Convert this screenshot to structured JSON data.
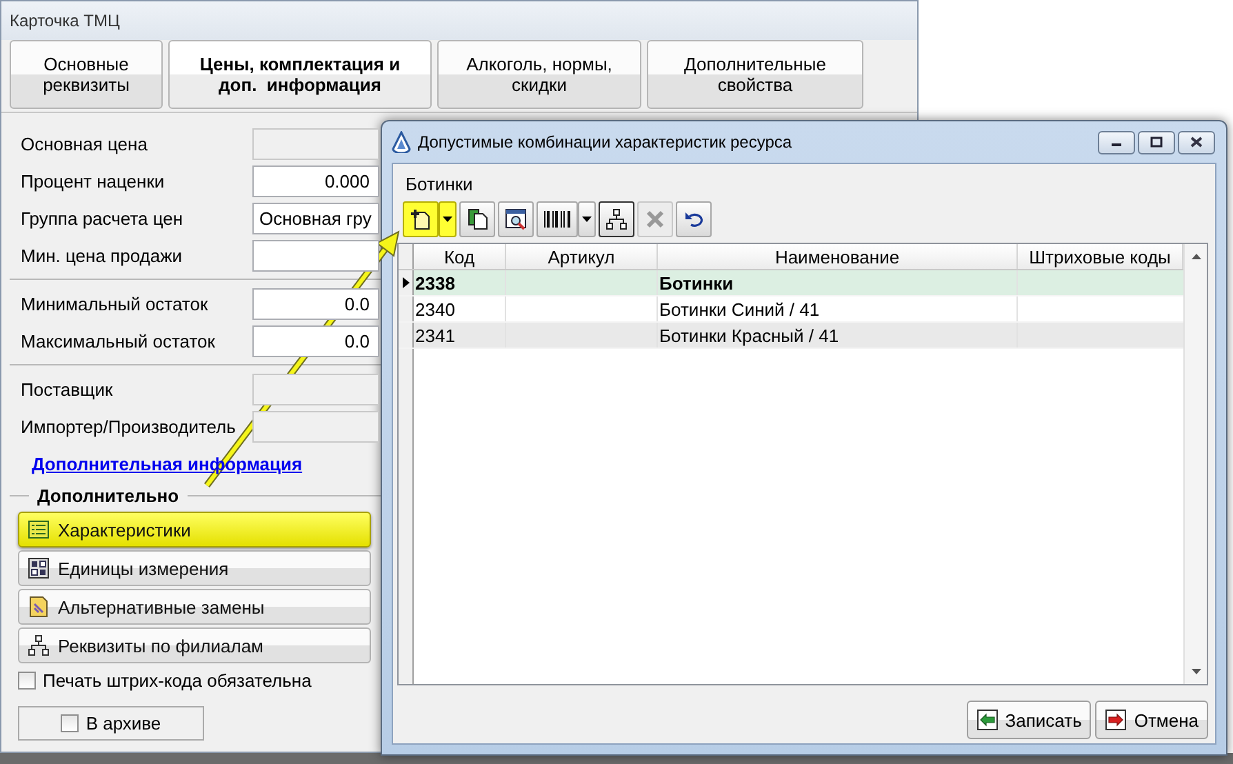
{
  "main_window": {
    "title": "Карточка ТМЦ",
    "tabs": [
      {
        "label": "Основные реквизиты",
        "selected": false
      },
      {
        "label": "Цены, комплектация и доп.  информация",
        "selected": true
      },
      {
        "label": "Алкоголь, нормы, скидки",
        "selected": false
      },
      {
        "label": "Дополнительные свойства",
        "selected": false
      }
    ],
    "field_groups": [
      [
        {
          "label": "Основная цена",
          "kind": "readonly"
        },
        {
          "label": "Процент наценки",
          "kind": "number",
          "value": "0.000"
        },
        {
          "label": "Группа расчета цен",
          "kind": "text",
          "value": "Основная гру"
        },
        {
          "label": "Мин. цена продажи",
          "kind": "number"
        }
      ],
      [
        {
          "label": "Минимальный остаток",
          "kind": "number",
          "value": "0.0"
        },
        {
          "label": "Максимальный остаток",
          "kind": "number",
          "value": "0.0"
        }
      ],
      [
        {
          "label": "Поставщик",
          "kind": "readonly"
        },
        {
          "label": "Импортер/Производитель",
          "kind": "readonly"
        }
      ]
    ],
    "link": "Дополнительная информация",
    "section_title": "Дополнительно",
    "buttons": [
      {
        "label": "Характеристики",
        "kind": "list",
        "highlighted": true
      },
      {
        "label": "Единицы измерения",
        "kind": "units",
        "highlighted": false
      },
      {
        "label": "Альтернативные замены",
        "kind": "document",
        "highlighted": false
      },
      {
        "label": "Реквизиты по филиалам",
        "kind": "tree",
        "highlighted": false
      }
    ],
    "print_checkbox": {
      "label": "Печать штрих-кода обязательна",
      "checked": false
    },
    "archive_button": {
      "label": "В архиве",
      "checked": false
    }
  },
  "dialog": {
    "title": "Допустимые комбинации характеристик ресурса",
    "caption": "Ботинки",
    "toolbar": [
      {
        "kind": "add",
        "highlighted": true,
        "dropdown": true,
        "pressed": false,
        "disabled": false
      },
      {
        "kind": "copy",
        "highlighted": false,
        "dropdown": false,
        "pressed": false,
        "disabled": false
      },
      {
        "kind": "preview",
        "highlighted": false,
        "dropdown": false,
        "pressed": false,
        "disabled": false
      },
      {
        "kind": "barcode",
        "highlighted": false,
        "dropdown": true,
        "pressed": false,
        "disabled": false
      },
      {
        "kind": "tree",
        "highlighted": false,
        "dropdown": false,
        "pressed": true,
        "disabled": false
      },
      {
        "kind": "delete",
        "highlighted": false,
        "dropdown": false,
        "pressed": false,
        "disabled": true
      },
      {
        "kind": "undo",
        "highlighted": false,
        "dropdown": false,
        "pressed": false,
        "disabled": false
      }
    ],
    "table": {
      "columns": [
        "Код",
        "Артикул",
        "Наименование",
        "Штриховые коды"
      ],
      "rows": [
        {
          "code": "2338",
          "name": "Ботинки",
          "kind": "group",
          "selected": true
        },
        {
          "code": "2340",
          "name": "Ботинки Синий / 41",
          "kind": "item",
          "selected": false
        },
        {
          "code": "2341",
          "name": "Ботинки Красный / 41",
          "kind": "item",
          "selected": false
        }
      ]
    },
    "buttons": [
      {
        "label": "Записать",
        "kind": "save"
      },
      {
        "label": "Отмена",
        "kind": "cancel"
      }
    ]
  }
}
